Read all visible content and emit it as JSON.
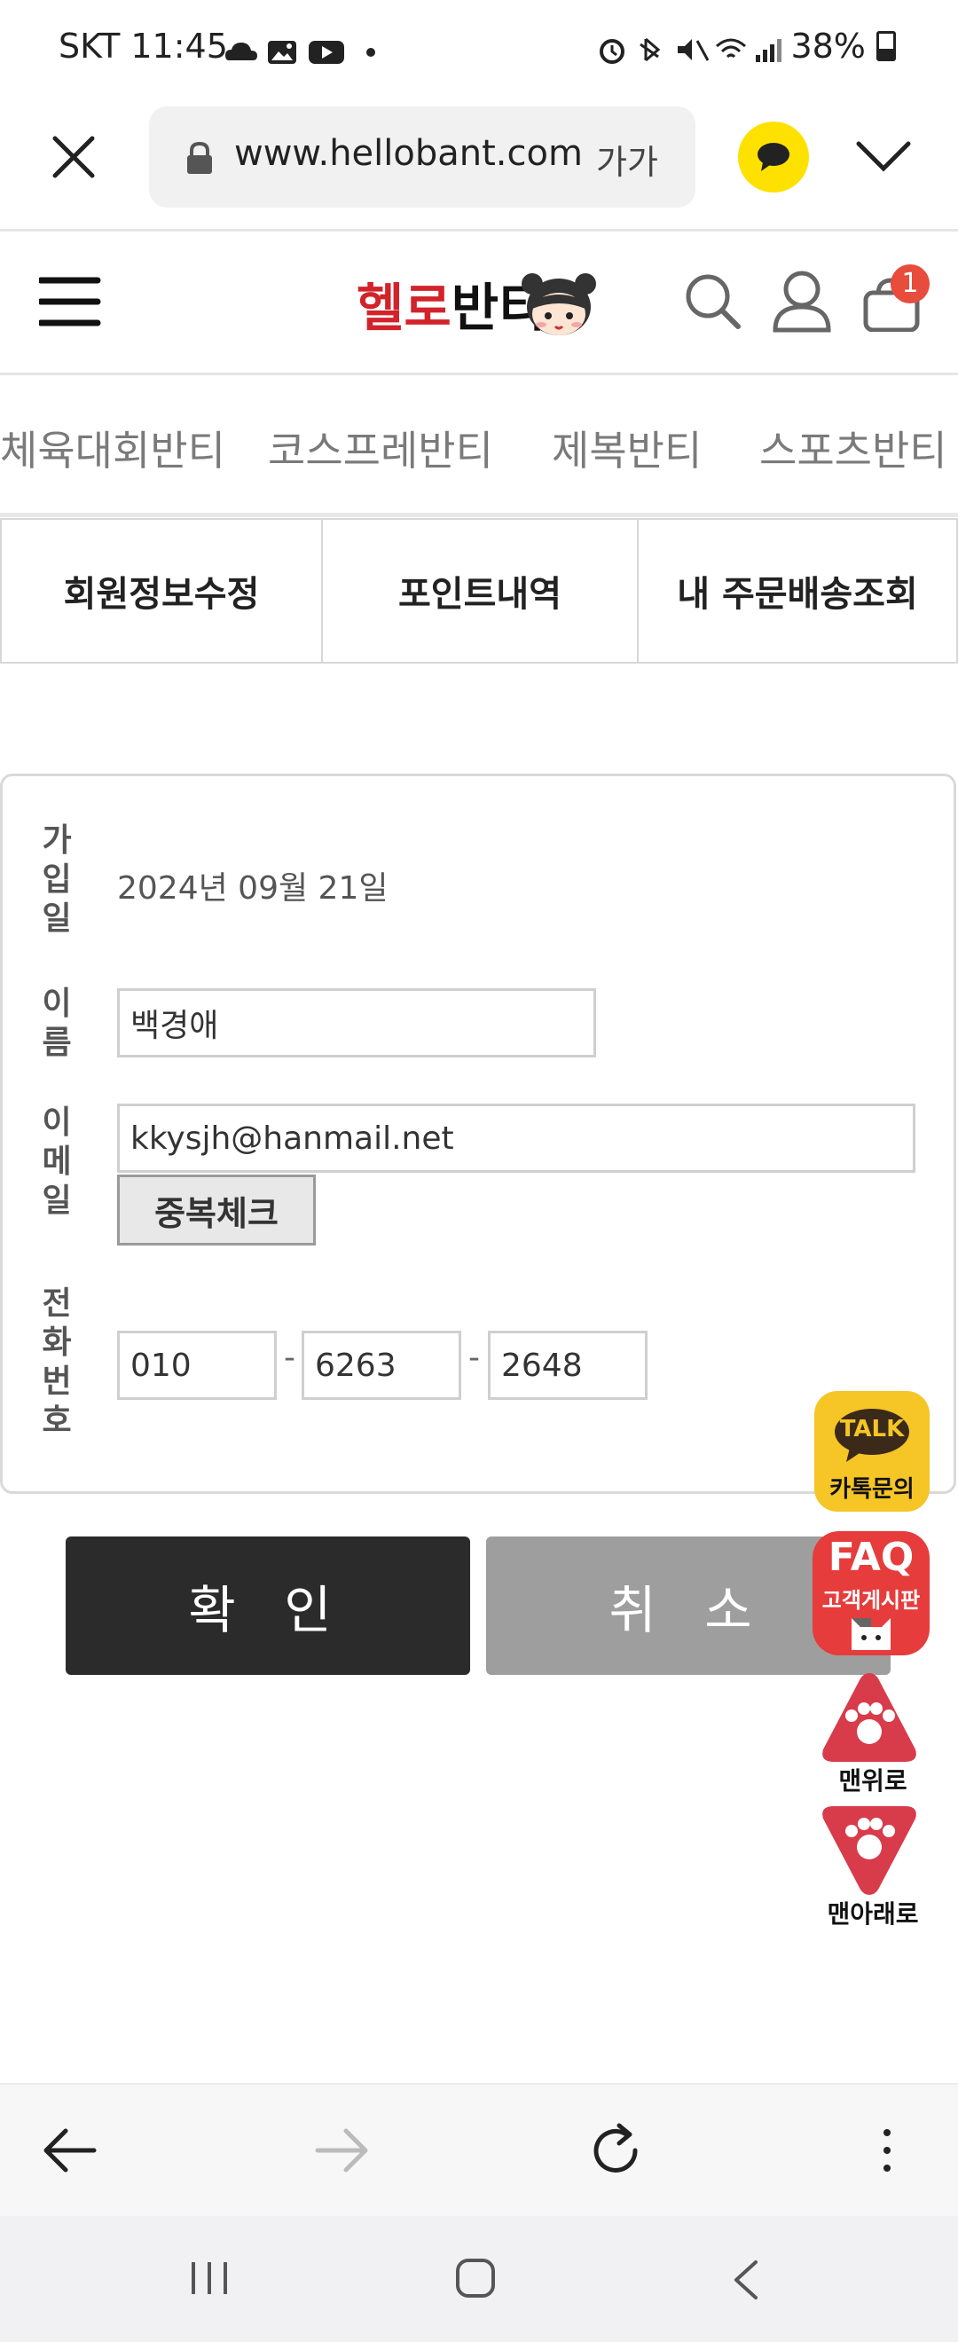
{
  "status_bar": {
    "carrier_time": "SKT 11:45",
    "battery": "38%"
  },
  "browser": {
    "url": "www.hellobant.com",
    "translate_label": "가가"
  },
  "header": {
    "logo_part1": "헬로",
    "logo_part2": "반티",
    "cart_count": "1"
  },
  "categories": [
    "체육대회반티",
    "코스프레반티",
    "제복반티",
    "스포츠반티"
  ],
  "tabs": [
    "회원정보수정",
    "포인트내역",
    "내 주문배송조회"
  ],
  "form": {
    "join_date_label": "가입일",
    "join_date_value": "2024년 09월 21일",
    "name_label": "이름",
    "name_value": "백경애",
    "email_label": "이메일",
    "email_value": "kkysjh@hanmail.net",
    "dup_check_label": "중복체크",
    "phone_label": "전화번호",
    "phone1": "010",
    "phone2": "6263",
    "phone3": "2648",
    "phone_separator": "-"
  },
  "buttons": {
    "confirm": "확 인",
    "cancel": "취 소"
  },
  "floating": {
    "talk_badge": "TALK",
    "talk_label": "카톡문의",
    "faq_title": "FAQ",
    "faq_label": "고객게시판",
    "top_label": "맨위로",
    "bottom_label": "맨아래로"
  },
  "colors": {
    "brand_red": "#d2232a",
    "confirm_bg": "#2b2b2b",
    "cancel_bg": "#9e9e9e",
    "kakao_yellow": "#ffe100"
  }
}
